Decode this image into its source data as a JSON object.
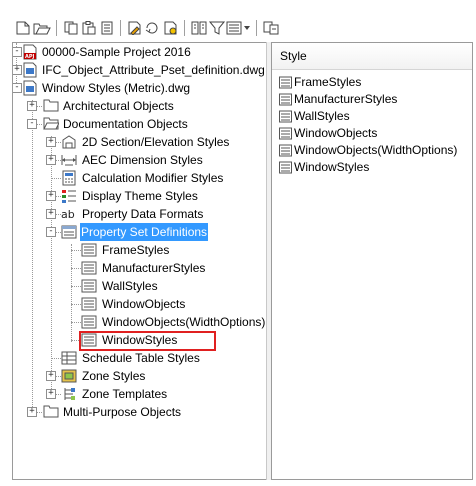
{
  "toolbar": {
    "buttons": [
      {
        "name": "new-drawing-icon"
      },
      {
        "name": "open-drawing-icon"
      },
      {
        "name": "copy-icon"
      },
      {
        "name": "paste-icon"
      },
      {
        "name": "purge-icon"
      },
      {
        "name": "edit-style-icon"
      },
      {
        "name": "set-current-icon"
      },
      {
        "name": "convert-icon"
      },
      {
        "name": "data-format-icon"
      },
      {
        "name": "filter-icon"
      },
      {
        "name": "view-mode-icon"
      },
      {
        "name": "sync-icon"
      }
    ]
  },
  "tree": {
    "nodes": [
      {
        "label": "00000-Sample Project 2016",
        "icon": "project-icon"
      },
      {
        "label": "IFC_Object_Attribute_Pset_definition.dwg",
        "icon": "drawing-icon"
      },
      {
        "label": "Window Styles (Metric).dwg",
        "icon": "drawing-icon"
      },
      {
        "label": "Architectural Objects",
        "icon": "folder-icon"
      },
      {
        "label": "Documentation Objects",
        "icon": "folder-open-icon"
      },
      {
        "label": "2D Section/Elevation Styles",
        "icon": "section-elevation-icon"
      },
      {
        "label": "AEC Dimension Styles",
        "icon": "dimension-icon"
      },
      {
        "label": "Calculation Modifier Styles",
        "icon": "calculation-icon"
      },
      {
        "label": "Display Theme Styles",
        "icon": "display-theme-icon"
      },
      {
        "label": "Property Data Formats",
        "icon": "property-format-icon"
      },
      {
        "label": "Property Set Definitions",
        "icon": "property-set-icon"
      },
      {
        "label": "FrameStyles",
        "icon": "property-set-item-icon"
      },
      {
        "label": "ManufacturerStyles",
        "icon": "property-set-item-icon"
      },
      {
        "label": "WallStyles",
        "icon": "property-set-item-icon"
      },
      {
        "label": "WindowObjects",
        "icon": "property-set-item-icon"
      },
      {
        "label": "WindowObjects(WidthOptions)",
        "icon": "property-set-item-icon"
      },
      {
        "label": "WindowStyles",
        "icon": "property-set-item-icon"
      },
      {
        "label": "Schedule Table Styles",
        "icon": "schedule-table-icon"
      },
      {
        "label": "Zone Styles",
        "icon": "zone-styles-icon"
      },
      {
        "label": "Zone Templates",
        "icon": "zone-templates-icon"
      },
      {
        "label": "Multi-Purpose Objects",
        "icon": "folder-icon"
      }
    ]
  },
  "list": {
    "header": "Style",
    "items": [
      "FrameStyles",
      "ManufacturerStyles",
      "WallStyles",
      "WindowObjects",
      "WindowObjects(WidthOptions)",
      "WindowStyles"
    ]
  },
  "colors": {
    "selection": "#3399ff",
    "highlight_box": "#e02020"
  }
}
